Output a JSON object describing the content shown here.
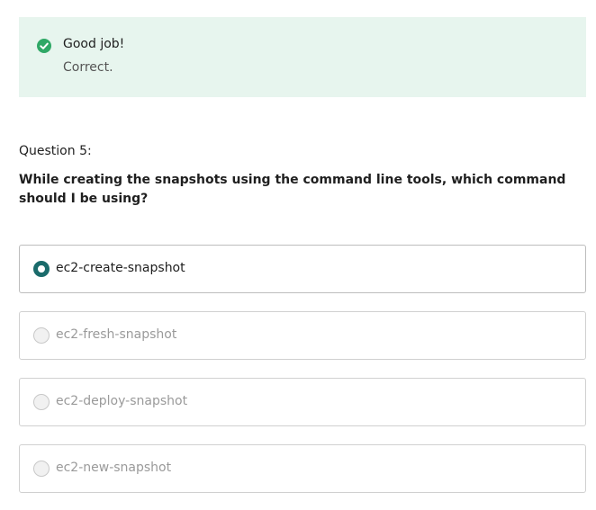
{
  "feedback": {
    "title": "Good job!",
    "message": "Correct.",
    "icon": "check-circle-icon",
    "color": "#2fa866",
    "background": "#e7f5ee"
  },
  "question": {
    "number_label": "Question 5:",
    "text": "While creating the snapshots using the command line tools, which command should I be using?"
  },
  "options": [
    {
      "label": "ec2-create-snapshot",
      "selected": true
    },
    {
      "label": "ec2-fresh-snapshot",
      "selected": false
    },
    {
      "label": "ec2-deploy-snapshot",
      "selected": false
    },
    {
      "label": "ec2-new-snapshot",
      "selected": false
    }
  ],
  "colors": {
    "radio_selected": "#1a6b6b"
  }
}
